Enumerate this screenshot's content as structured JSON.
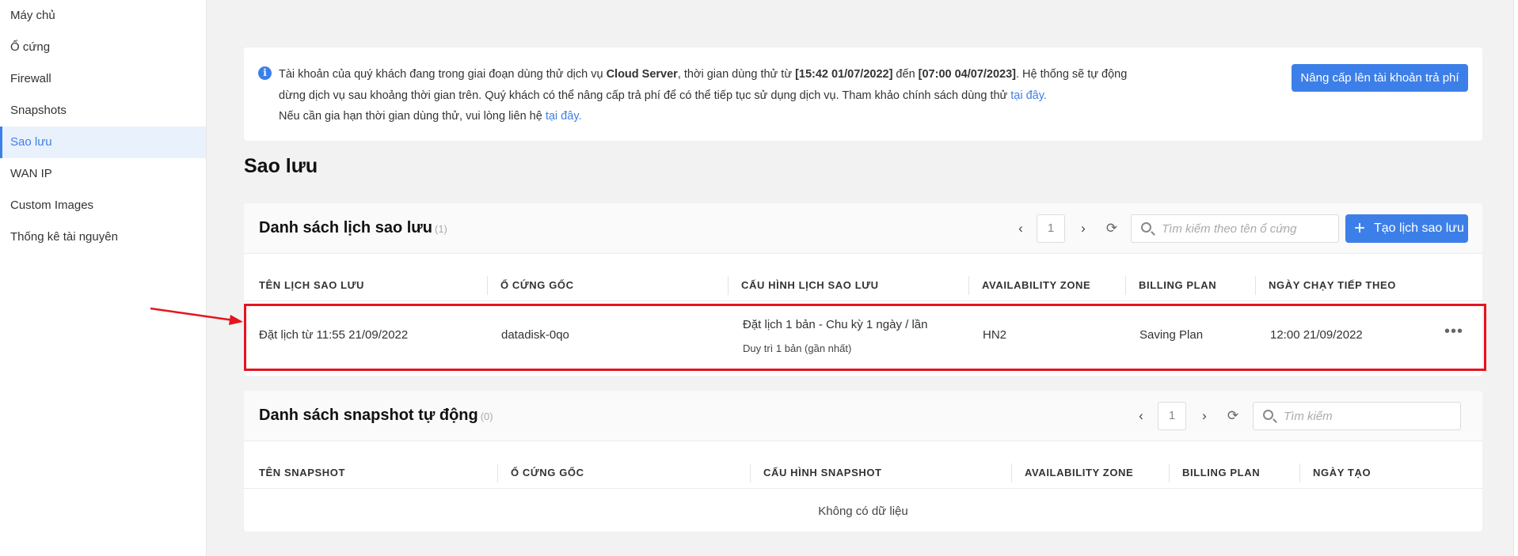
{
  "sidebar": {
    "items": [
      {
        "label": "Máy chủ",
        "active": false
      },
      {
        "label": "Ổ cứng",
        "active": false
      },
      {
        "label": "Firewall",
        "active": false
      },
      {
        "label": "Snapshots",
        "active": false
      },
      {
        "label": "Sao lưu",
        "active": true
      },
      {
        "label": "WAN IP",
        "active": false
      },
      {
        "label": "Custom Images",
        "active": false
      },
      {
        "label": "Thống kê tài nguyên",
        "active": false
      }
    ]
  },
  "notice": {
    "line1_pre": "Tài khoản của quý khách đang trong giai đoạn dùng thử dịch vụ ",
    "line1_service": "Cloud Server",
    "line1_mid": ", thời gian dùng thử từ ",
    "line1_start": "[15:42 01/07/2022]",
    "line1_to": " đến ",
    "line1_end": "[07:00 04/07/2023]",
    "line1_post": ". Hệ thống sẽ tự động dừng dịch vụ sau khoảng thời gian trên. Quý khách có thể nâng cấp trả phí để có thể tiếp tục sử dụng dịch vụ. Tham khảo chính sách dùng thử ",
    "link1": "tại đây.",
    "line2_pre": "Nếu cần gia hạn thời gian dùng thử, vui lòng liên hệ ",
    "link2": "tại đây.",
    "upgrade_label": "Nâng cấp lên tài khoản trả phí"
  },
  "page_title": "Sao lưu",
  "schedule_panel": {
    "title": "Danh sách lịch sao lưu",
    "count": "(1)",
    "page": "1",
    "search_placeholder": "Tìm kiếm theo tên ổ cứng",
    "create_label": "Tạo lịch sao lưu",
    "columns": [
      "TÊN LỊCH SAO LƯU",
      "Ổ CỨNG GỐC",
      "CẤU HÌNH LỊCH SAO LƯU",
      "AVAILABILITY ZONE",
      "BILLING PLAN",
      "NGÀY CHẠY TIẾP THEO"
    ],
    "rows": [
      {
        "name": "Đặt lịch từ 11:55 21/09/2022",
        "disk": "datadisk-0qo",
        "config": "Đặt lịch 1 bản - Chu kỳ 1 ngày / lần",
        "config_sub": "Duy trì 1 bản (gần nhất)",
        "zone": "HN2",
        "billing": "Saving Plan",
        "next_run": "12:00 21/09/2022",
        "actions": "•••"
      }
    ]
  },
  "snapshot_panel": {
    "title": "Danh sách snapshot tự động",
    "count": "(0)",
    "page": "1",
    "search_placeholder": "Tìm kiếm",
    "columns": [
      "TÊN SNAPSHOT",
      "Ổ CỨNG GỐC",
      "CẤU HÌNH SNAPSHOT",
      "AVAILABILITY ZONE",
      "BILLING PLAN",
      "NGÀY TẠO"
    ],
    "empty_text": "Không có dữ liệu"
  },
  "colors": {
    "accent": "#3d7fe8",
    "annotation": "#e5141e"
  },
  "icons": {
    "info": "info-circle-icon",
    "prev": "chevron-left-icon",
    "next": "chevron-right-icon",
    "refresh": "refresh-icon",
    "search": "search-icon",
    "plus": "plus-icon",
    "more": "more-horizontal-icon",
    "annotation": "arrow-annotation"
  }
}
